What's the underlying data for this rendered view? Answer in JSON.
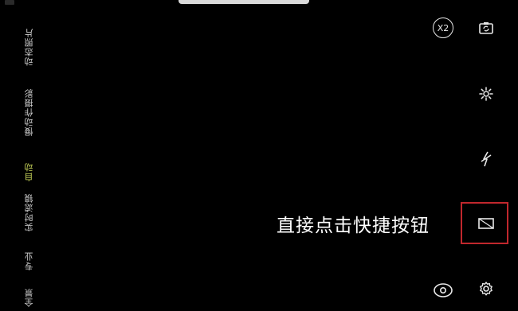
{
  "modes": [
    {
      "label": "动态照片",
      "active": false
    },
    {
      "label": "慢动作摄影",
      "active": false
    },
    {
      "label": "自动",
      "active": true
    },
    {
      "label": "实时滤镜",
      "active": false
    },
    {
      "label": "专业",
      "active": false
    },
    {
      "label": "全景",
      "active": false
    }
  ],
  "zoom": {
    "label": "X2"
  },
  "callout": {
    "text": "直接点击快捷按钮"
  },
  "icons": {
    "switch_camera": "switch-camera-icon",
    "flash": "flash-icon",
    "hdr": "hdr-icon",
    "aspect": "aspect-ratio-icon",
    "settings": "gear-icon",
    "filter": "filter-eye-icon"
  },
  "colors": {
    "background": "#000000",
    "active_mode": "#c8d45a",
    "highlight": "#c1272d"
  }
}
